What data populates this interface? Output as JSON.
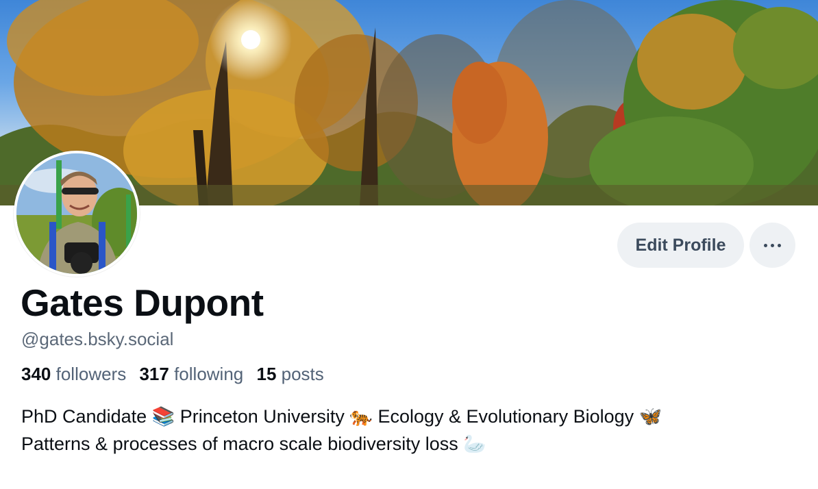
{
  "banner": {
    "description_icon": "banner-image"
  },
  "avatar": {
    "icon": "avatar-photo"
  },
  "actions": {
    "edit_label": "Edit Profile",
    "more_icon": "ellipsis-icon"
  },
  "profile": {
    "display_name": "Gates Dupont",
    "handle": "@gates.bsky.social"
  },
  "stats": {
    "followers_count": "340",
    "followers_label": "followers",
    "following_count": "317",
    "following_label": "following",
    "posts_count": "15",
    "posts_label": "posts"
  },
  "bio": {
    "line1": "PhD Candidate 📚 Princeton University 🐅 Ecology & Evolutionary Biology 🦋",
    "line2": "Patterns & processes of macro scale biodiversity loss 🦢"
  },
  "colors": {
    "text_primary": "#0b0f14",
    "text_secondary": "#536377",
    "button_bg": "#eef1f4"
  }
}
